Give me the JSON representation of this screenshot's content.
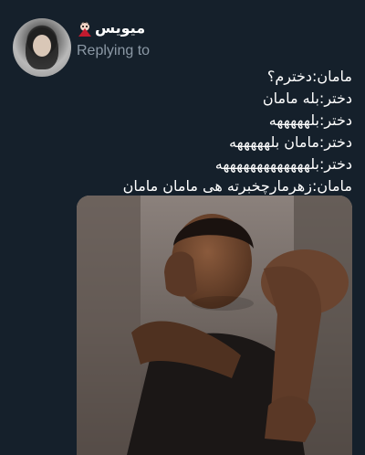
{
  "tweet": {
    "display_name": "میویس",
    "replying_to": "Replying to",
    "lines": [
      "مامان:دخترم؟",
      "دختر:بله مامان",
      "دختر:بلهههههه",
      "دختر:مامان بلهههههه",
      "دختر:بلهههههههههههههه",
      "مامان:زهرمارچخبرته هی مامان مامان"
    ]
  },
  "icons": {
    "name_emoji": "vampire-emoji-icon"
  },
  "colors": {
    "background": "#15202b",
    "text": "#ffffff",
    "secondary_text": "#8b98a5"
  }
}
